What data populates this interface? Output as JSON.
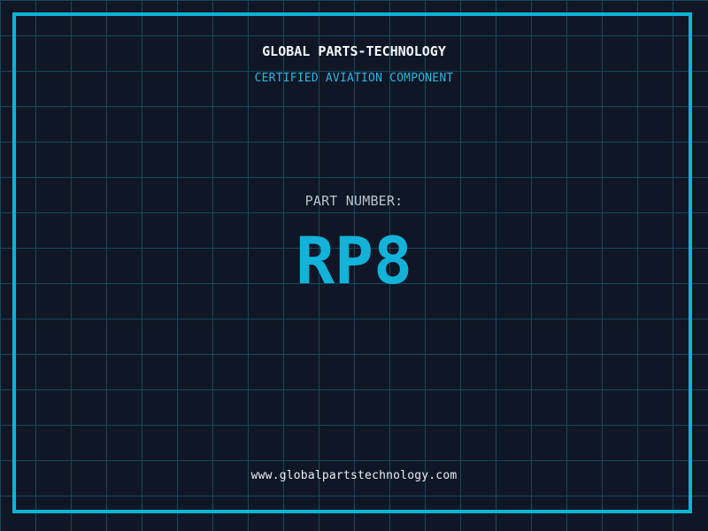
{
  "label": {
    "company_name": "GLOBAL PARTS-TECHNOLOGY",
    "certification": "CERTIFIED AVIATION COMPONENT",
    "part_label": "PART NUMBER:",
    "part_number": "RP8",
    "website": "www.globalpartstechnology.com"
  },
  "colors": {
    "background": "#0f1726",
    "grid_line": "#17485f",
    "frame_border": "#0cb4d6",
    "certification_cyan": "#2fb4de",
    "part_number_cyan": "#13b2d8",
    "title_white": "#f2f5f7",
    "label_gray": "#b7c3cd"
  }
}
